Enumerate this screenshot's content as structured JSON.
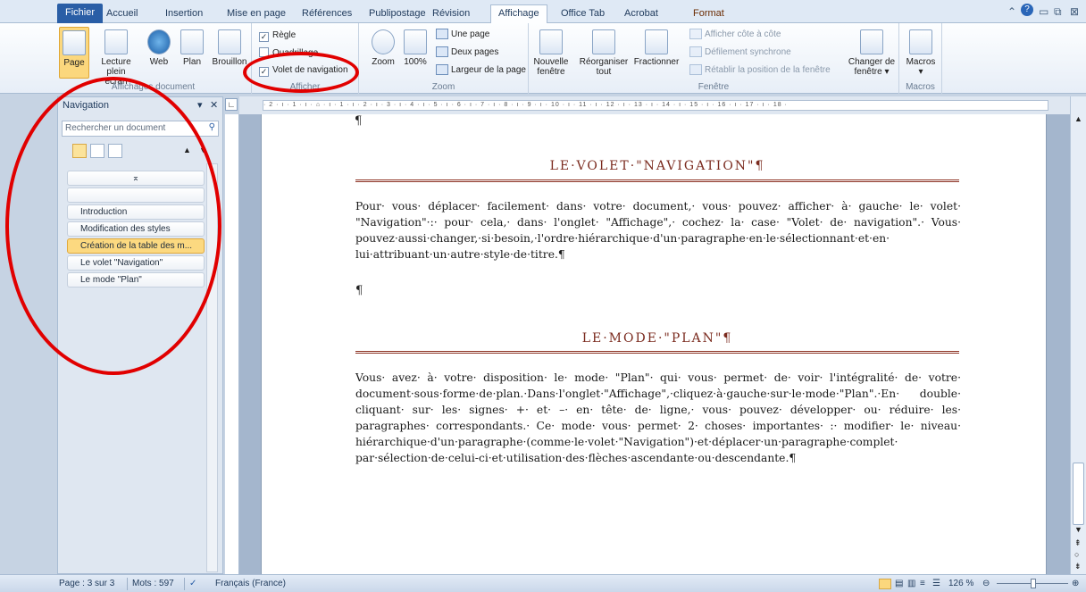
{
  "tabs": {
    "fichier": "Fichier",
    "accueil": "Accueil",
    "insertion": "Insertion",
    "mise_en_page": "Mise en page",
    "references": "Références",
    "publipostage": "Publipostage",
    "revision": "Révision",
    "affichage": "Affichage",
    "office_tab": "Office Tab",
    "acrobat": "Acrobat",
    "format": "Format"
  },
  "ribbon": {
    "affichages": {
      "label": "Affichages document",
      "page": "Page",
      "lecture_line1": "Lecture",
      "lecture_line2": "plein écran",
      "web": "Web",
      "plan": "Plan",
      "brouillon": "Brouillon"
    },
    "afficher": {
      "label": "Afficher",
      "regle": "Règle",
      "quadrillage": "Quadrillage",
      "volet": "Volet de navigation"
    },
    "zoom": {
      "label": "Zoom",
      "zoom": "Zoom",
      "cent": "100%",
      "une_page": "Une page",
      "deux_pages": "Deux pages",
      "largeur": "Largeur de la page"
    },
    "fenetre": {
      "label": "Fenêtre",
      "nouvelle_line1": "Nouvelle",
      "nouvelle_line2": "fenêtre",
      "reorganiser_line1": "Réorganiser",
      "reorganiser_line2": "tout",
      "fractionner": "Fractionner",
      "cote": "Afficher côte à côte",
      "defilement": "Défilement synchrone",
      "retablir": "Rétablir la position de la fenêtre",
      "changer_line1": "Changer de",
      "changer_line2": "fenêtre ▾"
    },
    "macros": {
      "label": "Macros",
      "macros": "Macros"
    }
  },
  "navigation": {
    "title": "Navigation",
    "search_placeholder": "Rechercher un document",
    "items": [
      "Introduction",
      "Modification des styles",
      "Création de la table des m...",
      "Le volet \"Navigation\"",
      "Le mode \"Plan\""
    ]
  },
  "ruler": {
    "ticks": "· 2 · ı · 1 · ı · ⌂ · ı · 1 · ı · 2 · ı · 3 · ı · 4 · ı · 5 · ı · 6 · ı · 7 · ı · 8 · ı · 9 · ı · 10 · ı · 11 · ı · 12 · ı · 13 · ı · 14 · ı · 15 · ı · 16 · ı · 17 · ı · 18 ·"
  },
  "document": {
    "pilcrow": "¶",
    "heading1": "LE·VOLET·\"NAVIGATION\"¶",
    "para1": "Pour· vous· déplacer· facilement· dans· votre· document,· vous· pouvez· afficher· à· gauche· le· volet· \"Navigation\"·:· pour· cela,· dans· l'onglet· \"Affichage\",· cochez· la· case· \"Volet· de· navigation\".· Vous· pouvez·aussi·changer,·si·besoin,·l'ordre·hiérarchique·d'un·paragraphe·en·le·sélectionnant·et·en· lui·attribuant·un·autre·style·de·titre.¶",
    "heading2": "LE·MODE·\"PLAN\"¶",
    "para2": "Vous· avez· à· votre· disposition· le· mode· \"Plan\"· qui· vous· permet· de· voir· l'intégralité· de· votre· document·sous·forme·de·plan.·Dans·l'onglet·\"Affichage\",·cliquez·à·gauche·sur·le·mode·\"Plan\".·En· double· cliquant· sur· les· signes· +· et· –· en· tête· de· ligne,· vous· pouvez· développer· ou· réduire· les· paragraphes· correspondants.· Ce· mode· vous· permet· 2· choses· importantes· :· modifier· le· niveau· hiérarchique·d'un·paragraphe·(comme·le·volet·\"Navigation\")·et·déplacer·un·paragraphe·complet· par·sélection·de·celui-ci·et·utilisation·des·flèches·ascendante·ou·descendante.¶"
  },
  "status": {
    "page": "Page : 3 sur 3",
    "mots": "Mots : 597",
    "langue": "Français (France)",
    "zoom": "126 %"
  },
  "colors": {
    "annotation": "#e10000",
    "heading": "#7b2b1f",
    "selected": "#fcd980"
  }
}
